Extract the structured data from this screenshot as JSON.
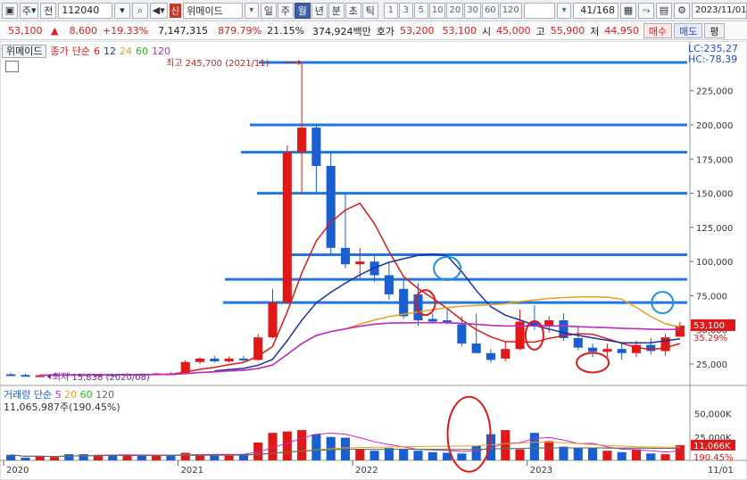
{
  "toolbar": {
    "period_select": "주",
    "prev_label": "전",
    "stock_code": "112040",
    "shin_label": "신",
    "stock_name": "위메이드",
    "period_tabs": [
      "일",
      "주",
      "월",
      "년",
      "분",
      "초",
      "틱"
    ],
    "active_period": "월",
    "interval_buttons": [
      "1",
      "3",
      "5",
      "10",
      "20",
      "30",
      "60",
      "120"
    ],
    "count_display": "41",
    "count_total": "/168",
    "date_value": "2023/11/01"
  },
  "quote": {
    "price": "53,100",
    "change_arrow": "▲",
    "change": "8,600",
    "change_pct": "+19.33%",
    "volume": "7,147,315",
    "vol_ratio": "879.79%",
    "turnover_rate": "21.15%",
    "amount": "374,924백만",
    "bid_label": "호가",
    "bid1": "53,200",
    "bid2": "53,100",
    "open_label": "시",
    "open": "45,000",
    "high_label": "고",
    "high": "55,900",
    "low_label": "저",
    "low": "44,950",
    "buy_label": "매수",
    "sell_label": "매도",
    "eval_label": "평"
  },
  "legend": {
    "name_tab": "위메이드",
    "type": "종가",
    "ma_label": "단순",
    "ma_periods": [
      "6",
      "12",
      "24",
      "60",
      "120"
    ],
    "ma_colors": [
      "#e01818",
      "#1a2fa8",
      "#e8a020",
      "#1fc21f",
      "#d020d0"
    ],
    "lc_line": "LC:235,27",
    "hc_line": "HC:-78,39"
  },
  "annotations": {
    "high_marker": "최고 245,700 (2021/11)",
    "low_marker": "최저 15,838 (2020/08)"
  },
  "axis": {
    "price_ticks": [
      "225,000",
      "200,000",
      "175,000",
      "150,000",
      "125,000",
      "100,000",
      "75,000",
      "50,000",
      "25,000"
    ],
    "current_price_tag": "53,100",
    "current_pct_tag": "35.29%",
    "volume_ticks": [
      "50,000K",
      "25,000K"
    ],
    "volume_tag": "11,066K",
    "volume_pct_tag": "190.45%",
    "time_labels": [
      "2020",
      "2021",
      "2022",
      "2023",
      "11/01"
    ]
  },
  "volume_legend": {
    "label": "거래량",
    "ma_label": "단순",
    "ma_periods": [
      "5",
      "20",
      "60",
      "120"
    ],
    "ma_colors": [
      "#d020d0",
      "#e8a020",
      "#1fc21f",
      "#666666"
    ],
    "summary": "11,065,987주(190.45%)"
  },
  "colors": {
    "up": "#e01818",
    "down": "#1a5fd0",
    "hline": "#1f78e0",
    "circle_red": "#e01818",
    "circle_blue": "#1f8fe0"
  },
  "chart_data": {
    "type": "candlestick",
    "unit": "KRW",
    "ylim": [
      10000,
      245700
    ],
    "months": [
      "2020-01",
      "2020-02",
      "2020-03",
      "2020-04",
      "2020-05",
      "2020-06",
      "2020-07",
      "2020-08",
      "2020-09",
      "2020-10",
      "2020-11",
      "2020-12",
      "2021-01",
      "2021-02",
      "2021-03",
      "2021-04",
      "2021-05",
      "2021-06",
      "2021-07",
      "2021-08",
      "2021-09",
      "2021-10",
      "2021-11",
      "2021-12",
      "2022-01",
      "2022-02",
      "2022-03",
      "2022-04",
      "2022-05",
      "2022-06",
      "2022-07",
      "2022-08",
      "2022-09",
      "2022-10",
      "2022-11",
      "2022-12",
      "2023-01",
      "2023-02",
      "2023-03",
      "2023-04",
      "2023-05",
      "2023-06",
      "2023-07",
      "2023-08",
      "2023-09",
      "2023-10",
      "2023-11"
    ],
    "candles": [
      [
        17500,
        18500,
        16500,
        17000
      ],
      [
        17000,
        18000,
        16000,
        16500
      ],
      [
        16500,
        17500,
        15838,
        16800
      ],
      [
        16800,
        18000,
        16500,
        17600
      ],
      [
        17600,
        18500,
        17000,
        17500
      ],
      [
        17500,
        18200,
        16800,
        17300
      ],
      [
        17300,
        18000,
        16800,
        17400
      ],
      [
        17400,
        18000,
        15838,
        16900
      ],
      [
        16900,
        18200,
        16500,
        17800
      ],
      [
        17800,
        18400,
        16800,
        17200
      ],
      [
        17200,
        18500,
        16900,
        18100
      ],
      [
        18100,
        19000,
        17500,
        17900
      ],
      [
        17900,
        28000,
        17800,
        26500
      ],
      [
        26500,
        30000,
        25000,
        29000
      ],
      [
        29000,
        31000,
        26000,
        27000
      ],
      [
        27000,
        30500,
        26000,
        29000
      ],
      [
        29000,
        31000,
        27000,
        28000
      ],
      [
        28000,
        47000,
        27500,
        44500
      ],
      [
        44500,
        80000,
        44000,
        70000
      ],
      [
        70000,
        185000,
        69000,
        180000
      ],
      [
        180000,
        245700,
        150000,
        198000
      ],
      [
        198000,
        200000,
        150000,
        170000
      ],
      [
        170000,
        180000,
        105000,
        110000
      ],
      [
        110000,
        150000,
        95000,
        98000
      ],
      [
        98000,
        110000,
        88000,
        100000
      ],
      [
        100000,
        106000,
        85000,
        90000
      ],
      [
        90000,
        100000,
        72000,
        76000
      ],
      [
        80000,
        86000,
        58000,
        60000
      ],
      [
        76000,
        84000,
        53000,
        57000
      ],
      [
        58000,
        62000,
        55000,
        56000
      ],
      [
        57000,
        65000,
        54000,
        55000
      ],
      [
        54000,
        60000,
        38000,
        40000
      ],
      [
        40000,
        62000,
        34000,
        33000
      ],
      [
        33000,
        36000,
        26000,
        28000
      ],
      [
        29000,
        42000,
        27000,
        36000
      ],
      [
        36000,
        65000,
        35000,
        56000
      ],
      [
        56000,
        68000,
        50000,
        53000
      ],
      [
        53000,
        60000,
        48000,
        57000
      ],
      [
        57000,
        62000,
        42000,
        44000
      ],
      [
        44000,
        52000,
        35000,
        37000
      ],
      [
        37000,
        40000,
        30000,
        34000
      ],
      [
        34000,
        40000,
        30000,
        36000
      ],
      [
        36000,
        40000,
        28000,
        33000
      ],
      [
        33000,
        42000,
        30000,
        39000
      ],
      [
        39000,
        44000,
        32000,
        34500
      ],
      [
        34500,
        47000,
        31000,
        44500
      ],
      [
        45000,
        55900,
        44950,
        53100
      ]
    ],
    "volume_k": [
      4000,
      2000,
      3000,
      2500,
      4500,
      4500,
      4000,
      4000,
      3500,
      3500,
      4000,
      4000,
      5500,
      4000,
      4500,
      4000,
      4500,
      13000,
      20000,
      21000,
      22000,
      19000,
      17000,
      16500,
      8000,
      7000,
      9000,
      8500,
      7000,
      6000,
      5500,
      5000,
      10500,
      19000,
      22000,
      8000,
      20000,
      14000,
      10000,
      9000,
      9000,
      7000,
      6000,
      8000,
      5000,
      4500,
      11066
    ]
  }
}
